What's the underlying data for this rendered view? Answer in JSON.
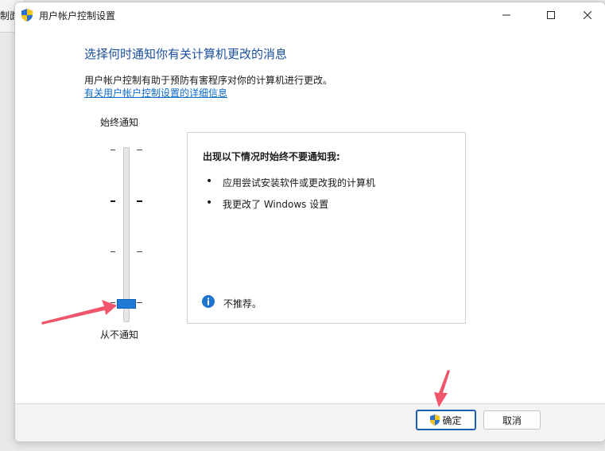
{
  "background_window": {
    "partial_title": "制面"
  },
  "window": {
    "title": "用户帐户控制设置"
  },
  "heading": "选择何时通知你有关计算机更改的消息",
  "description": "用户帐户控制有助于预防有害程序对你的计算机进行更改。",
  "link": "有关用户帐户控制设置的详细信息",
  "slider": {
    "top_label": "始终通知",
    "bottom_label": "从不通知",
    "levels": 4,
    "selected_level": 1
  },
  "info_box": {
    "heading": "出现以下情况时始终不要通知我:",
    "items": [
      "应用尝试安装软件或更改我的计算机",
      "我更改了 Windows 设置"
    ],
    "note": "不推荐。"
  },
  "buttons": {
    "ok": "确定",
    "cancel": "取消"
  },
  "colors": {
    "accent": "#1f7ad8",
    "heading": "#1a4f9c",
    "link": "#0a6bc9",
    "annotation_arrow": "#f0556a"
  },
  "icons": [
    "uac-shield-icon",
    "minimize-icon",
    "maximize-icon",
    "close-icon",
    "info-icon",
    "annotation-arrow-icon"
  ]
}
